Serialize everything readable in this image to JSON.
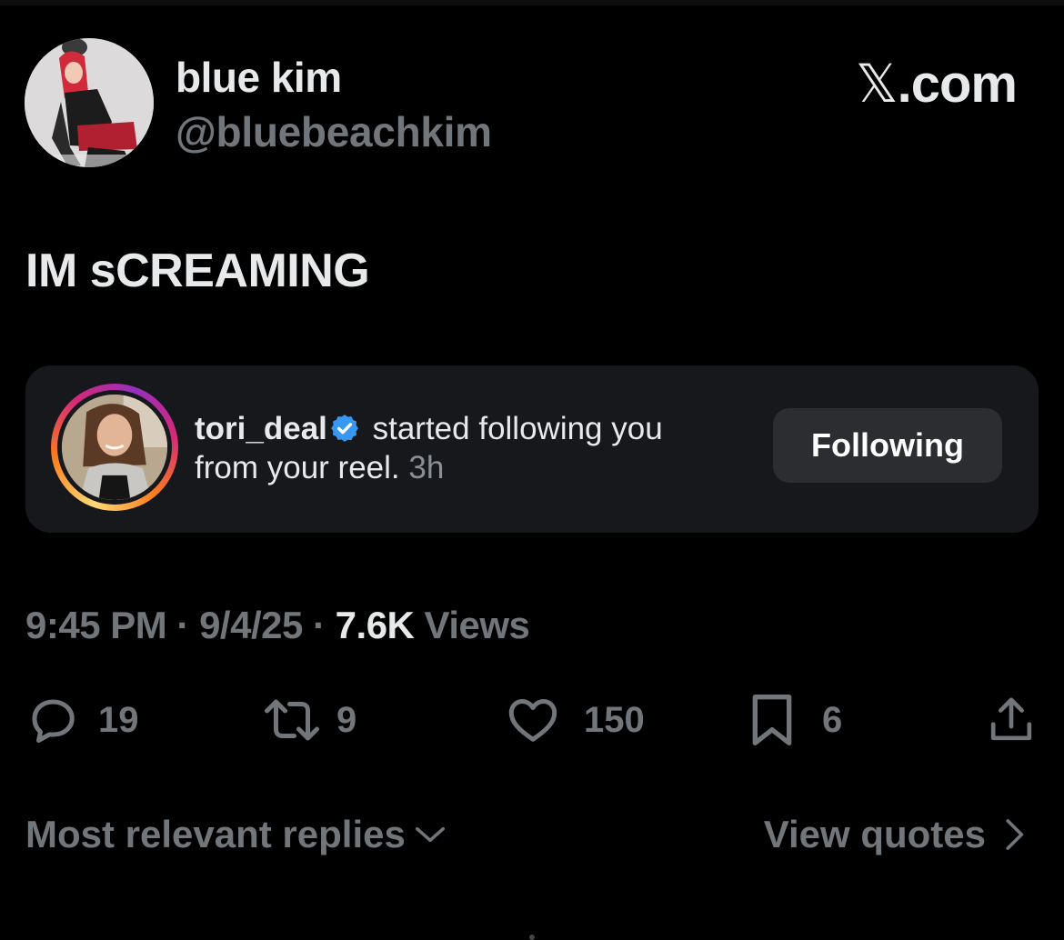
{
  "author": {
    "display_name": "blue kim",
    "handle": "@bluebeachkim"
  },
  "brand": {
    "x_glyph": "𝕏",
    "suffix": ".com"
  },
  "tweet": {
    "text": "IM sCREAMING"
  },
  "embedded_notification": {
    "username": "tori_deal",
    "verified": true,
    "message_part1": " started following you",
    "message_part2": "from your reel.",
    "time": "3h",
    "button_label": "Following"
  },
  "meta": {
    "time": "9:45 PM",
    "separator": " · ",
    "date": "9/4/25",
    "views_count": "7.6K",
    "views_label": " Views"
  },
  "actions": {
    "replies": "19",
    "reposts": "9",
    "likes": "150",
    "bookmarks": "6"
  },
  "footer": {
    "sort_label": "Most relevant replies",
    "quotes_label": "View quotes"
  },
  "colors": {
    "background": "#000000",
    "text_primary": "#e7e9ea",
    "text_secondary": "#71767b",
    "card": "#16181c",
    "verified_blue": "#1d9bf0"
  }
}
